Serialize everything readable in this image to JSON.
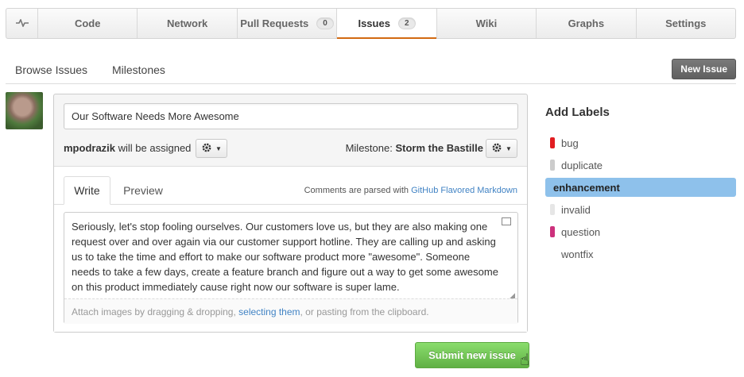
{
  "nav": {
    "tabs": [
      {
        "label": "Code"
      },
      {
        "label": "Network"
      },
      {
        "label": "Pull Requests",
        "count": "0"
      },
      {
        "label": "Issues",
        "count": "2",
        "active": true
      },
      {
        "label": "Wiki"
      },
      {
        "label": "Graphs"
      },
      {
        "label": "Settings"
      }
    ]
  },
  "subnav": {
    "browse_issues": "Browse Issues",
    "milestones": "Milestones",
    "new_issue": "New Issue"
  },
  "form": {
    "title_value": "Our Software Needs More Awesome",
    "assignee_user": "mpodrazik",
    "assignee_suffix": " will be assigned",
    "milestone_prefix": "Milestone: ",
    "milestone_value": "Storm the Bastille",
    "write_tab": "Write",
    "preview_tab": "Preview",
    "md_note_prefix": "Comments are parsed with ",
    "md_note_link": "GitHub Flavored Markdown",
    "body_text": "Seriously, let's stop fooling ourselves. Our customers love us, but they are also making one request over and over again via our customer support hotline. They are calling up and asking us to take the time and effort to make our software product more \"awesome\". Someone needs to take a few days, create a feature branch and figure out a way to get some awesome on this product immediately cause right now our software is super lame.",
    "attach_prefix": "Attach images by dragging & dropping, ",
    "attach_link": "selecting them",
    "attach_suffix": ", or pasting from the clipboard.",
    "submit": "Submit new issue"
  },
  "labels": {
    "title": "Add Labels",
    "items": [
      {
        "name": "bug",
        "color": "#e11d21"
      },
      {
        "name": "duplicate",
        "color": "#cccccc"
      },
      {
        "name": "enhancement",
        "color": "#84b6eb",
        "selected": true
      },
      {
        "name": "invalid",
        "color": "#e6e6e6"
      },
      {
        "name": "question",
        "color": "#cc317c"
      },
      {
        "name": "wontfix",
        "color": "#ffffff"
      }
    ]
  },
  "colors": {
    "active_tab_underline": "#d26911",
    "submit_green": "#60b044",
    "link_blue": "#4183c4",
    "selected_label_bg": "#8ec1eb"
  }
}
